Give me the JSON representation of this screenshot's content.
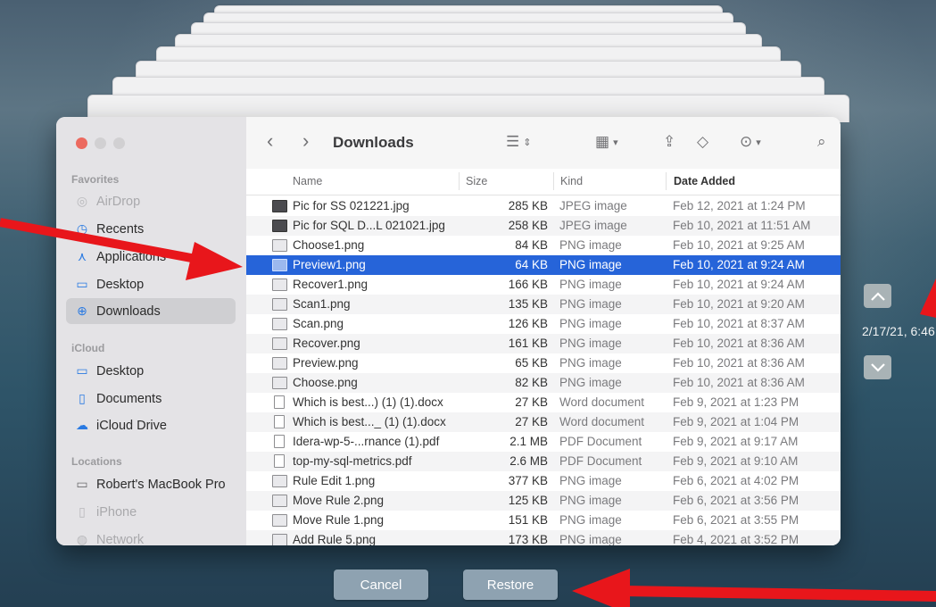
{
  "colors": {
    "accent": "#2664d9",
    "close": "#ec6a5f",
    "minimize": "#d1d0d2",
    "zoom": "#d1d0d2",
    "arrow": "#e8161b"
  },
  "sidebar": {
    "favorites_header": "Favorites",
    "favorites": [
      {
        "label": "AirDrop",
        "icon": "airdrop-icon",
        "dim": true
      },
      {
        "label": "Recents",
        "icon": "clock-icon",
        "dim": false
      },
      {
        "label": "Applications",
        "icon": "applications-icon",
        "dim": false
      },
      {
        "label": "Desktop",
        "icon": "desktop-icon",
        "dim": false
      },
      {
        "label": "Downloads",
        "icon": "download-icon",
        "dim": false,
        "selected": true
      }
    ],
    "icloud_header": "iCloud",
    "icloud": [
      {
        "label": "Desktop",
        "icon": "desktop-icon"
      },
      {
        "label": "Documents",
        "icon": "document-icon"
      },
      {
        "label": "iCloud Drive",
        "icon": "cloud-icon"
      }
    ],
    "locations_header": "Locations",
    "locations": [
      {
        "label": "Robert's MacBook Pro",
        "icon": "laptop-icon",
        "dim": false
      },
      {
        "label": "iPhone",
        "icon": "phone-icon",
        "dim": true
      },
      {
        "label": "Network",
        "icon": "network-icon",
        "dim": true
      }
    ]
  },
  "toolbar": {
    "title": "Downloads",
    "back": "‹",
    "forward": "›"
  },
  "columns": {
    "name": "Name",
    "size": "Size",
    "kind": "Kind",
    "date": "Date Added"
  },
  "files": [
    {
      "name": "Pic for SS 021221.jpg",
      "size": "285 KB",
      "kind": "JPEG image",
      "date": "Feb 12, 2021 at 1:24 PM",
      "icon": "dark"
    },
    {
      "name": "Pic for SQL D...L 021021.jpg",
      "size": "258 KB",
      "kind": "JPEG image",
      "date": "Feb 10, 2021 at 11:51 AM",
      "icon": "dark"
    },
    {
      "name": "Choose1.png",
      "size": "84 KB",
      "kind": "PNG image",
      "date": "Feb 10, 2021 at 9:25 AM",
      "icon": "img"
    },
    {
      "name": "Preview1.png",
      "size": "64 KB",
      "kind": "PNG image",
      "date": "Feb 10, 2021 at 9:24 AM",
      "icon": "img",
      "selected": true
    },
    {
      "name": "Recover1.png",
      "size": "166 KB",
      "kind": "PNG image",
      "date": "Feb 10, 2021 at 9:24 AM",
      "icon": "img"
    },
    {
      "name": "Scan1.png",
      "size": "135 KB",
      "kind": "PNG image",
      "date": "Feb 10, 2021 at 9:20 AM",
      "icon": "img"
    },
    {
      "name": "Scan.png",
      "size": "126 KB",
      "kind": "PNG image",
      "date": "Feb 10, 2021 at 8:37 AM",
      "icon": "img"
    },
    {
      "name": "Recover.png",
      "size": "161 KB",
      "kind": "PNG image",
      "date": "Feb 10, 2021 at 8:36 AM",
      "icon": "img"
    },
    {
      "name": "Preview.png",
      "size": "65 KB",
      "kind": "PNG image",
      "date": "Feb 10, 2021 at 8:36 AM",
      "icon": "img"
    },
    {
      "name": "Choose.png",
      "size": "82 KB",
      "kind": "PNG image",
      "date": "Feb 10, 2021 at 8:36 AM",
      "icon": "img"
    },
    {
      "name": "Which is best...) (1) (1).docx",
      "size": "27 KB",
      "kind": "Word document",
      "date": "Feb 9, 2021 at 1:23 PM",
      "icon": "doc"
    },
    {
      "name": "Which is best..._ (1) (1).docx",
      "size": "27 KB",
      "kind": "Word document",
      "date": "Feb 9, 2021 at 1:04 PM",
      "icon": "doc"
    },
    {
      "name": "Idera-wp-5-...rnance (1).pdf",
      "size": "2.1 MB",
      "kind": "PDF Document",
      "date": "Feb 9, 2021 at 9:17 AM",
      "icon": "doc"
    },
    {
      "name": "top-my-sql-metrics.pdf",
      "size": "2.6 MB",
      "kind": "PDF Document",
      "date": "Feb 9, 2021 at 9:10 AM",
      "icon": "doc"
    },
    {
      "name": "Rule Edit 1.png",
      "size": "377 KB",
      "kind": "PNG image",
      "date": "Feb 6, 2021 at 4:02 PM",
      "icon": "img"
    },
    {
      "name": "Move Rule 2.png",
      "size": "125 KB",
      "kind": "PNG image",
      "date": "Feb 6, 2021 at 3:56 PM",
      "icon": "img"
    },
    {
      "name": "Move Rule 1.png",
      "size": "151 KB",
      "kind": "PNG image",
      "date": "Feb 6, 2021 at 3:55 PM",
      "icon": "img"
    },
    {
      "name": "Add Rule 5.png",
      "size": "173 KB",
      "kind": "PNG image",
      "date": "Feb 4, 2021 at 3:52 PM",
      "icon": "img"
    }
  ],
  "timeline": {
    "timestamp": "2/17/21, 6:46"
  },
  "buttons": {
    "cancel": "Cancel",
    "restore": "Restore"
  }
}
